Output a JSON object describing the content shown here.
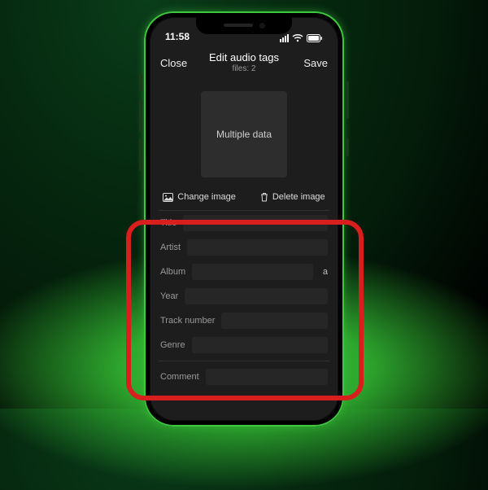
{
  "status": {
    "time": "11:58"
  },
  "nav": {
    "close": "Close",
    "title": "Edit audio tags",
    "subtitle": "files: 2",
    "save": "Save"
  },
  "artwork": {
    "placeholder": "Multiple data"
  },
  "image_actions": {
    "change": "Change image",
    "delete": "Delete image"
  },
  "fields": {
    "title": {
      "label": "Title",
      "value": ""
    },
    "artist": {
      "label": "Artist",
      "value": ""
    },
    "album": {
      "label": "Album",
      "value": "a"
    },
    "year": {
      "label": "Year",
      "value": ""
    },
    "track_number": {
      "label": "Track number",
      "value": ""
    },
    "genre": {
      "label": "Genre",
      "value": ""
    },
    "comment": {
      "label": "Comment",
      "value": ""
    }
  }
}
